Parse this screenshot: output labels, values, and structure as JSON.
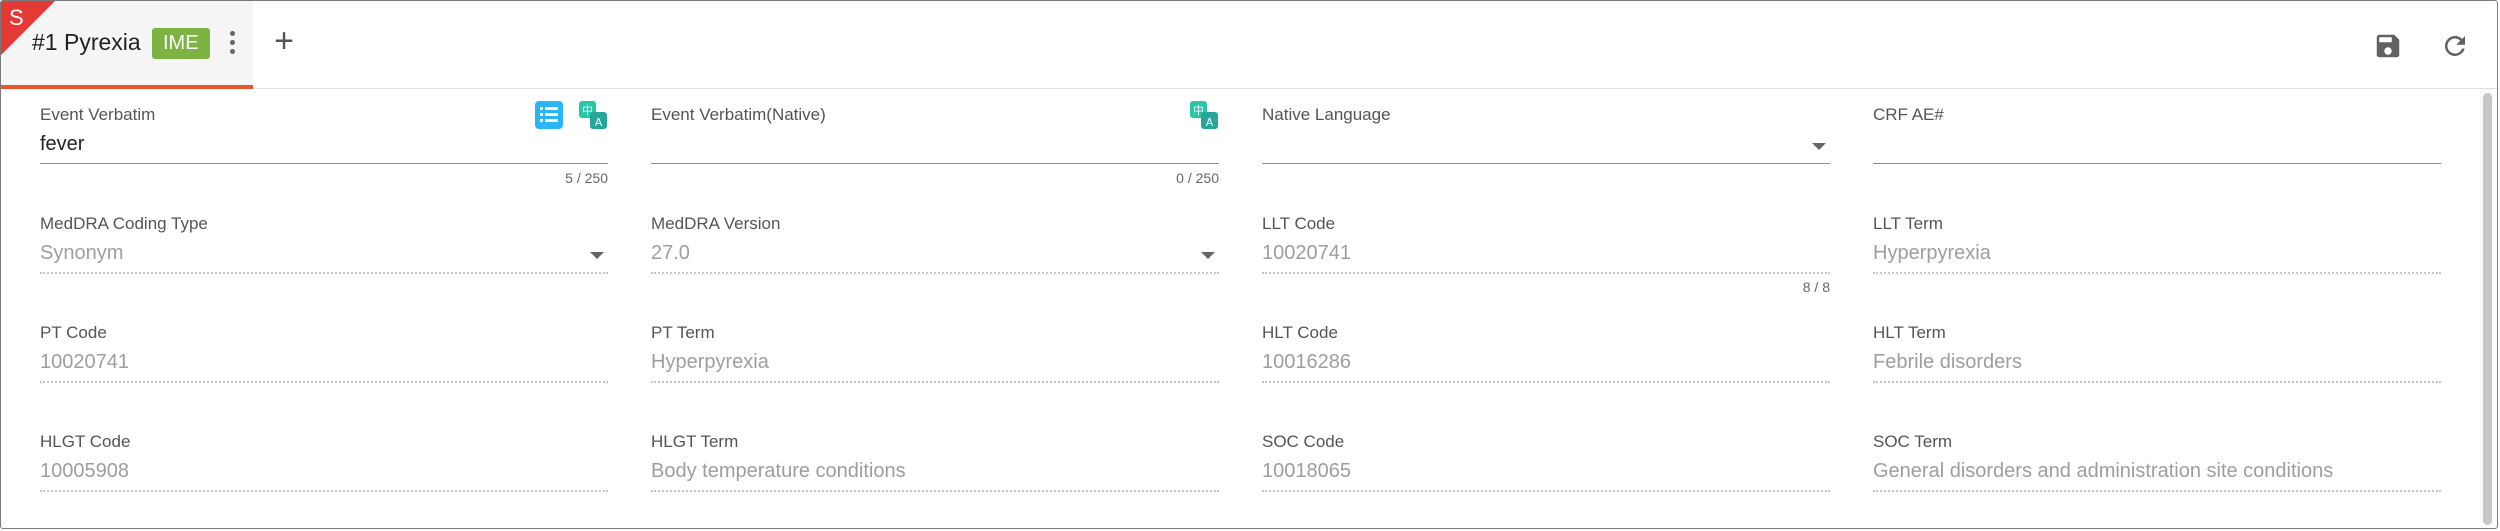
{
  "tab": {
    "corner_letter": "S",
    "title": "#1 Pyrexia",
    "badge": "IME"
  },
  "toolbar": {
    "add_symbol": "+",
    "save_icon": "save-icon",
    "refresh_icon": "refresh-icon"
  },
  "colors": {
    "tab_accent": "#e8542e",
    "corner": "#e53935",
    "badge": "#7cb342",
    "list_icon": "#29b6f6",
    "translate_icon": "#26c6a6"
  },
  "fields": {
    "event_verbatim": {
      "label": "Event Verbatim",
      "value": "fever",
      "counter": "5 / 250"
    },
    "event_verbatim_native": {
      "label": "Event Verbatim(Native)",
      "value": "",
      "counter": "0 / 250"
    },
    "native_language": {
      "label": "Native Language",
      "value": ""
    },
    "crf_ae": {
      "label": "CRF AE#",
      "value": ""
    },
    "meddra_coding_type": {
      "label": "MedDRA Coding Type",
      "value": "Synonym"
    },
    "meddra_version": {
      "label": "MedDRA Version",
      "value": "27.0"
    },
    "llt_code": {
      "label": "LLT Code",
      "value": "10020741",
      "counter": "8 / 8"
    },
    "llt_term": {
      "label": "LLT Term",
      "value": "Hyperpyrexia"
    },
    "pt_code": {
      "label": "PT Code",
      "value": "10020741"
    },
    "pt_term": {
      "label": "PT Term",
      "value": "Hyperpyrexia"
    },
    "hlt_code": {
      "label": "HLT Code",
      "value": "10016286"
    },
    "hlt_term": {
      "label": "HLT Term",
      "value": "Febrile disorders"
    },
    "hlgt_code": {
      "label": "HLGT Code",
      "value": "10005908"
    },
    "hlgt_term": {
      "label": "HLGT Term",
      "value": "Body temperature conditions"
    },
    "soc_code": {
      "label": "SOC Code",
      "value": "10018065"
    },
    "soc_term": {
      "label": "SOC Term",
      "value": "General disorders and administration site conditions"
    }
  }
}
